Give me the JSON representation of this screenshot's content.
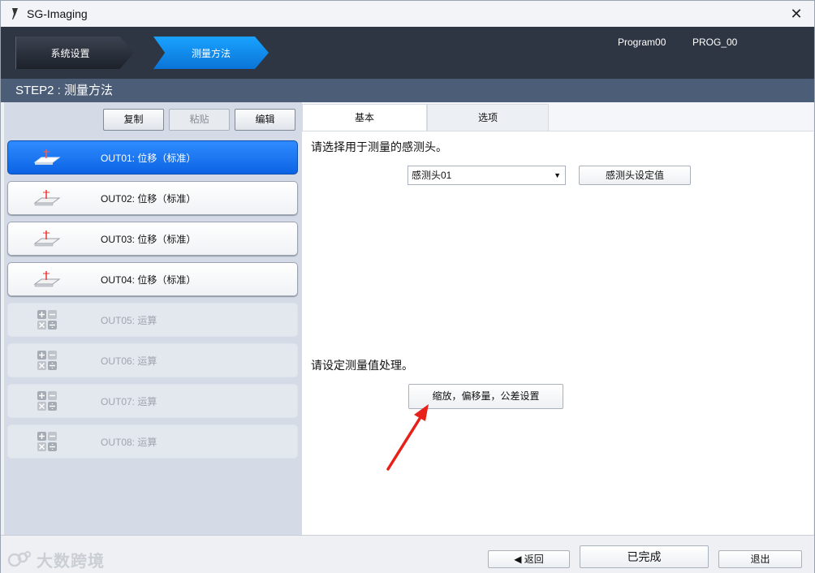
{
  "window": {
    "title": "SG-Imaging",
    "close_glyph": "✕"
  },
  "header": {
    "breadcrumbs": [
      {
        "label": "系统设置",
        "state": "inactive"
      },
      {
        "label": "测量方法",
        "state": "active"
      }
    ],
    "program_name": "Program00",
    "program_id": "PROG_00"
  },
  "step_title": "STEP2 : 测量方法",
  "left_toolbar": {
    "copy_label": "复制",
    "paste_label": "粘贴",
    "edit_label": "编辑"
  },
  "outputs": [
    {
      "label": "OUT01: 位移（标准）",
      "icon": "displacement-icon",
      "state": "active"
    },
    {
      "label": "OUT02: 位移（标准）",
      "icon": "displacement-icon",
      "state": "normal"
    },
    {
      "label": "OUT03: 位移（标准）",
      "icon": "displacement-icon",
      "state": "normal"
    },
    {
      "label": "OUT04: 位移（标准）",
      "icon": "displacement-icon",
      "state": "normal"
    },
    {
      "label": "OUT05: 运算",
      "icon": "calculation-icon",
      "state": "disabled"
    },
    {
      "label": "OUT06: 运算",
      "icon": "calculation-icon",
      "state": "disabled"
    },
    {
      "label": "OUT07: 运算",
      "icon": "calculation-icon",
      "state": "disabled"
    },
    {
      "label": "OUT08: 运算",
      "icon": "calculation-icon",
      "state": "disabled"
    }
  ],
  "tabs": [
    {
      "label": "基本",
      "selected": true
    },
    {
      "label": "选项",
      "selected": false
    }
  ],
  "basic": {
    "sensor_prompt": "请选择用于测量的感测头。",
    "sensor_select_value": "感测头01",
    "sensor_setting_button": "感测头设定值",
    "process_prompt": "请设定测量值处理。",
    "scale_button": "缩放，偏移量，公差设置"
  },
  "footer": {
    "back_label": "◀ 返回",
    "done_label": "已完成",
    "exit_label": "退出",
    "watermark": "大数跨境"
  },
  "colors": {
    "accent_blue": "#0b63e4",
    "header_bg": "#2f3643",
    "step_bar": "#4c5d78",
    "annotation_red": "#e8201a"
  }
}
